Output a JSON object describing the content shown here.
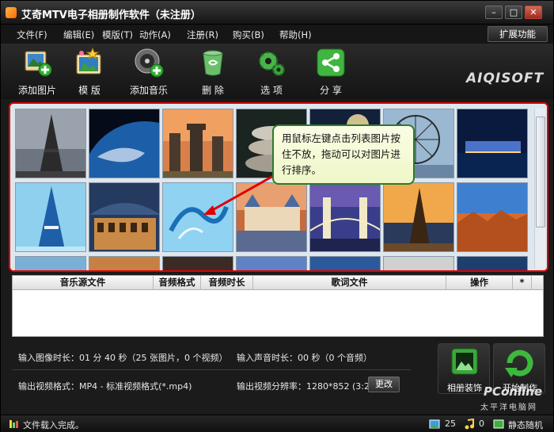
{
  "window": {
    "title": "艾奇MTV电子相册制作软件（未注册）"
  },
  "menu": {
    "items": [
      "文件(F)",
      "编辑(E)",
      "模版(T)",
      "动作(A)",
      "注册(R)",
      "购买(B)",
      "帮助(H)"
    ],
    "expand": "扩展功能"
  },
  "toolbar": {
    "add_image": "添加图片",
    "template": "模 版",
    "add_music": "添加音乐",
    "delete": "删 除",
    "options": "选 项",
    "share": "分 享",
    "brand": "AIQISOFT"
  },
  "tooltip": {
    "text": "用鼠标左键点击列表图片按住不放，拖动可以对图片进行排序。"
  },
  "music_table": {
    "columns": [
      "音乐源文件",
      "音频格式",
      "音频时长",
      "歌词文件",
      "操作",
      "*"
    ]
  },
  "info": {
    "image_duration_label": "输入图像时长：",
    "image_duration_value": "01 分 40 秒（25 张图片，0 个视频）",
    "audio_duration_label": "输入声音时长：",
    "audio_duration_value": "00 秒（0 个音频）",
    "video_format_label": "输出视频格式：",
    "video_format_value": "MP4 - 标准视频格式(*.mp4)",
    "resolution_label": "输出视频分辨率：",
    "resolution_value": "1280*852 (3:2)",
    "change_button": "更改"
  },
  "actions": {
    "album_decor": "相册装饰",
    "start_make": "开始制作"
  },
  "status": {
    "text": "文件载入完成。",
    "image_count": "25",
    "audio_count": "0",
    "mode": "静态随机"
  },
  "watermark": {
    "line1": "PConline",
    "line2": "太平洋电脑网"
  },
  "colors": {
    "highlight_border": "#e00000",
    "tooltip_border": "#2d7b2d",
    "arrow": "#e00000"
  }
}
